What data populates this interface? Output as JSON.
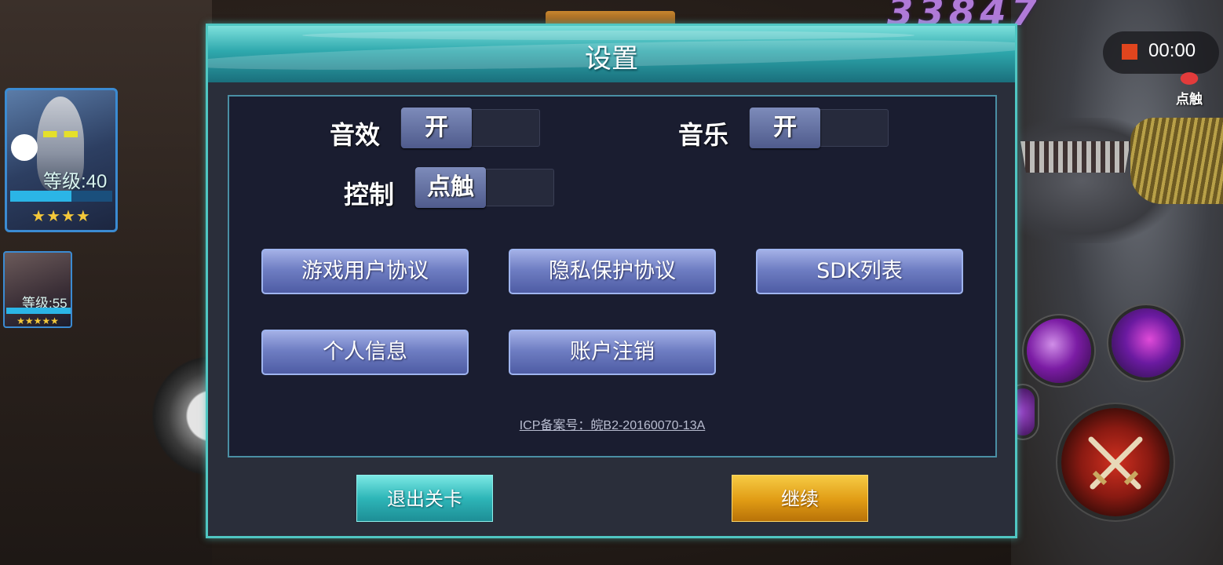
{
  "hud": {
    "score": "33847",
    "recording_time": "00:00",
    "touch_label": "点触",
    "hero_1": {
      "level": "等级:40",
      "stars": "★★★★"
    },
    "hero_2": {
      "level": "等级:55",
      "stars": "★★★★★"
    }
  },
  "dialog": {
    "title": "设置",
    "options": {
      "sound_effects": {
        "label": "音效",
        "value": "开"
      },
      "music": {
        "label": "音乐",
        "value": "开"
      },
      "control": {
        "label": "控制",
        "value": "点触"
      }
    },
    "buttons": {
      "user_agreement": "游戏用户协议",
      "privacy_agreement": "隐私保护协议",
      "sdk_list": "SDK列表",
      "personal_info": "个人信息",
      "account_cancel": "账户注销"
    },
    "icp": "ICP备案号：皖B2-20160070-13A",
    "footer": {
      "exit_stage": "退出关卡",
      "continue": "继续"
    }
  },
  "colors": {
    "dialog_border": "#4fc6c2",
    "exit_button": "#2eb6b8",
    "continue_button": "#e09b14",
    "menu_button": "#6f7ec3",
    "record_indicator": "#e0451e"
  },
  "icons": [
    "record-stop-icon",
    "touch-icon",
    "skill-icon",
    "attack-swords-icon",
    "joystick"
  ]
}
